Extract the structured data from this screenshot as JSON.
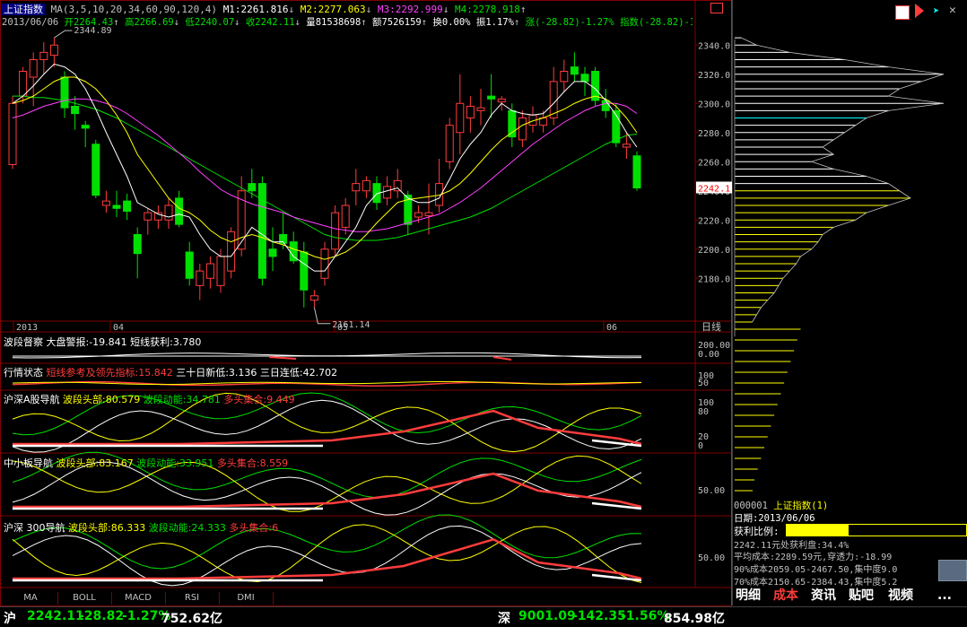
{
  "header": {
    "title": "上证指数",
    "ma_label": "MA(3,5,10,20,34,60,90,120,4)",
    "m1": "M1:2261.816",
    "m2": "M2:2277.063",
    "m3": "M3:2292.999",
    "m4": "M4:2278.918",
    "date": "2013/06/06",
    "open": "开2264.43",
    "high": "高2266.69",
    "low": "低2240.07",
    "close": "收2242.11",
    "volume": "量81538698",
    "amount": "额7526159",
    "turnover": "换0.00%",
    "amplitude": "振1.17%",
    "change": "涨(-28.82)-1.27%",
    "index": "指数(-28.82)-1.27"
  },
  "annotations": {
    "high_label": "2344.89",
    "low_label": "2161.14",
    "current_price": "2242.1"
  },
  "x_axis": {
    "labels": [
      "2013",
      "04",
      "05",
      "06"
    ],
    "period": "日线"
  },
  "indicators": [
    {
      "name": "波段督察",
      "items": [
        {
          "text": "大盘警报:-19.841",
          "color": "#ffffff"
        },
        {
          "text": "短线获利:3.780",
          "color": "#ffffff"
        }
      ],
      "axis": [
        "200.00",
        "0.00"
      ]
    },
    {
      "name": "行情状态",
      "items": [
        {
          "text": "短线参考及领先指标:15.842",
          "color": "#ff3c3c"
        },
        {
          "text": "三十日新低:3.136",
          "color": "#ffffff"
        },
        {
          "text": "三日连低:42.702",
          "color": "#ffffff"
        }
      ],
      "axis": [
        "100",
        "50"
      ]
    },
    {
      "name": "沪深A股导航",
      "items": [
        {
          "text": "波段头部:80.579",
          "color": "#ffff00"
        },
        {
          "text": "波段动能:34.781",
          "color": "#00e000"
        },
        {
          "text": "多头集合:9.449",
          "color": "#ff3c3c"
        }
      ],
      "axis": [
        "100",
        "80",
        "20",
        "0"
      ]
    },
    {
      "name": "中小板导航",
      "items": [
        {
          "text": "波段头部:83.167",
          "color": "#ffff00"
        },
        {
          "text": "波段动能:33.951",
          "color": "#00e000"
        },
        {
          "text": "多头集合:8.559",
          "color": "#ff3c3c"
        }
      ],
      "axis": [
        "50.00"
      ]
    },
    {
      "name": "沪深 300导航",
      "items": [
        {
          "text": "波段头部:86.333",
          "color": "#ffff00"
        },
        {
          "text": "波段动能:24.333",
          "color": "#00e000"
        },
        {
          "text": "多头集合:6",
          "color": "#ff3c3c"
        }
      ],
      "axis": [
        "50.00"
      ]
    }
  ],
  "bottom_tabs": [
    "MA",
    "BOLL",
    "MACD",
    "RSI",
    "DMI"
  ],
  "status_bar": {
    "sh_label": "沪",
    "sh_value": "2242.11",
    "sh_change": "-28.82",
    "sh_pct": "-1.27%",
    "sh_amount": "752.62亿",
    "sz_label": "深",
    "sz_value": "9001.09",
    "sz_change": "-142.35",
    "sz_pct": "-1.56%",
    "sz_amount": "854.98亿"
  },
  "right_panel": {
    "code": "000001",
    "name": "上证指数(1)",
    "date": "日期:2013/06/06",
    "profit_label": "获利比例:",
    "profit_value": "34.4%",
    "profit_fraction": 0.344,
    "line1": "2242.11元处获利盘:34.4%",
    "line2": "平均成本:2289.59元,穿透力:-18.99",
    "line3": "90%成本2059.05-2467.50,集中度9.0",
    "line4": "70%成本2150.65-2384.43,集中度5.2",
    "tabs": [
      "明细",
      "成本",
      "资讯",
      "贴吧",
      "视频"
    ],
    "more": "..."
  },
  "colors": {
    "up": "#ff3c3c",
    "down": "#00e000",
    "ma5": "#ffffff",
    "ma10": "#ffff00",
    "ma20": "#ff40ff",
    "ma60": "#00e000",
    "frame": "#800000"
  },
  "chart_data": {
    "type": "candlestick",
    "title": "上证指数",
    "ylim": [
      2150,
      2350
    ],
    "yticks": [
      2180,
      2200,
      2220,
      2240,
      2260,
      2280,
      2300,
      2320,
      2340
    ],
    "candles": [
      {
        "o": 2258,
        "h": 2305,
        "l": 2255,
        "c": 2300
      },
      {
        "o": 2305,
        "h": 2325,
        "l": 2300,
        "c": 2322
      },
      {
        "o": 2318,
        "h": 2335,
        "l": 2298,
        "c": 2330
      },
      {
        "o": 2330,
        "h": 2342,
        "l": 2320,
        "c": 2335
      },
      {
        "o": 2333,
        "h": 2345,
        "l": 2325,
        "c": 2340
      },
      {
        "o": 2318,
        "h": 2322,
        "l": 2290,
        "c": 2297
      },
      {
        "o": 2298,
        "h": 2305,
        "l": 2282,
        "c": 2293
      },
      {
        "o": 2285,
        "h": 2288,
        "l": 2270,
        "c": 2283
      },
      {
        "o": 2272,
        "h": 2275,
        "l": 2235,
        "c": 2237
      },
      {
        "o": 2230,
        "h": 2240,
        "l": 2225,
        "c": 2233
      },
      {
        "o": 2230,
        "h": 2240,
        "l": 2222,
        "c": 2228
      },
      {
        "o": 2233,
        "h": 2238,
        "l": 2220,
        "c": 2226
      },
      {
        "o": 2210,
        "h": 2215,
        "l": 2180,
        "c": 2197
      },
      {
        "o": 2220,
        "h": 2228,
        "l": 2210,
        "c": 2225
      },
      {
        "o": 2220,
        "h": 2230,
        "l": 2214,
        "c": 2225
      },
      {
        "o": 2220,
        "h": 2235,
        "l": 2214,
        "c": 2230
      },
      {
        "o": 2235,
        "h": 2240,
        "l": 2215,
        "c": 2217
      },
      {
        "o": 2198,
        "h": 2205,
        "l": 2175,
        "c": 2180
      },
      {
        "o": 2175,
        "h": 2190,
        "l": 2165,
        "c": 2185
      },
      {
        "o": 2180,
        "h": 2195,
        "l": 2173,
        "c": 2190
      },
      {
        "o": 2175,
        "h": 2200,
        "l": 2170,
        "c": 2195
      },
      {
        "o": 2185,
        "h": 2215,
        "l": 2180,
        "c": 2212
      },
      {
        "o": 2200,
        "h": 2250,
        "l": 2195,
        "c": 2240
      },
      {
        "o": 2245,
        "h": 2255,
        "l": 2235,
        "c": 2240
      },
      {
        "o": 2245,
        "h": 2250,
        "l": 2175,
        "c": 2180
      },
      {
        "o": 2200,
        "h": 2215,
        "l": 2185,
        "c": 2195
      },
      {
        "o": 2210,
        "h": 2225,
        "l": 2200,
        "c": 2204
      },
      {
        "o": 2205,
        "h": 2212,
        "l": 2190,
        "c": 2192
      },
      {
        "o": 2198,
        "h": 2205,
        "l": 2160,
        "c": 2172
      },
      {
        "o": 2165,
        "h": 2172,
        "l": 2160,
        "c": 2168
      },
      {
        "o": 2180,
        "h": 2205,
        "l": 2175,
        "c": 2200
      },
      {
        "o": 2200,
        "h": 2230,
        "l": 2195,
        "c": 2225
      },
      {
        "o": 2215,
        "h": 2235,
        "l": 2210,
        "c": 2230
      },
      {
        "o": 2240,
        "h": 2255,
        "l": 2230,
        "c": 2245
      },
      {
        "o": 2240,
        "h": 2250,
        "l": 2235,
        "c": 2247
      },
      {
        "o": 2245,
        "h": 2250,
        "l": 2227,
        "c": 2232
      },
      {
        "o": 2235,
        "h": 2250,
        "l": 2230,
        "c": 2243
      },
      {
        "o": 2240,
        "h": 2255,
        "l": 2235,
        "c": 2247
      },
      {
        "o": 2237,
        "h": 2240,
        "l": 2210,
        "c": 2217
      },
      {
        "o": 2222,
        "h": 2230,
        "l": 2218,
        "c": 2225
      },
      {
        "o": 2223,
        "h": 2245,
        "l": 2210,
        "c": 2225
      },
      {
        "o": 2230,
        "h": 2262,
        "l": 2225,
        "c": 2245
      },
      {
        "o": 2260,
        "h": 2290,
        "l": 2255,
        "c": 2285
      },
      {
        "o": 2280,
        "h": 2320,
        "l": 2265,
        "c": 2300
      },
      {
        "o": 2290,
        "h": 2305,
        "l": 2280,
        "c": 2298
      },
      {
        "o": 2295,
        "h": 2310,
        "l": 2285,
        "c": 2297
      },
      {
        "o": 2305,
        "h": 2320,
        "l": 2290,
        "c": 2303
      },
      {
        "o": 2301,
        "h": 2305,
        "l": 2295,
        "c": 2303
      },
      {
        "o": 2295,
        "h": 2300,
        "l": 2270,
        "c": 2277
      },
      {
        "o": 2275,
        "h": 2295,
        "l": 2270,
        "c": 2290
      },
      {
        "o": 2285,
        "h": 2298,
        "l": 2280,
        "c": 2292
      },
      {
        "o": 2285,
        "h": 2295,
        "l": 2280,
        "c": 2290
      },
      {
        "o": 2290,
        "h": 2325,
        "l": 2285,
        "c": 2315
      },
      {
        "o": 2315,
        "h": 2330,
        "l": 2308,
        "c": 2322
      },
      {
        "o": 2325,
        "h": 2335,
        "l": 2315,
        "c": 2320
      },
      {
        "o": 2320,
        "h": 2325,
        "l": 2305,
        "c": 2315
      },
      {
        "o": 2322,
        "h": 2325,
        "l": 2298,
        "c": 2302
      },
      {
        "o": 2302,
        "h": 2310,
        "l": 2290,
        "c": 2295
      },
      {
        "o": 2295,
        "h": 2300,
        "l": 2270,
        "c": 2273
      },
      {
        "o": 2270,
        "h": 2280,
        "l": 2262,
        "c": 2272
      },
      {
        "o": 2264,
        "h": 2267,
        "l": 2240,
        "c": 2242
      }
    ],
    "ma5": [
      2300,
      2305,
      2312,
      2320,
      2327,
      2325,
      2320,
      2310,
      2296,
      2280,
      2265,
      2250,
      2232,
      2228,
      2224,
      2222,
      2224,
      2222,
      2210,
      2200,
      2195,
      2195,
      2205,
      2215,
      2210,
      2205,
      2205,
      2195,
      2190,
      2185,
      2185,
      2195,
      2205,
      2215,
      2230,
      2238,
      2240,
      2242,
      2235,
      2232,
      2232,
      2235,
      2248,
      2262,
      2272,
      2280,
      2292,
      2300,
      2295,
      2293,
      2292,
      2293,
      2300,
      2308,
      2315,
      2315,
      2310,
      2302,
      2292,
      2280,
      2270
    ],
    "ma10": [
      2300,
      2302,
      2305,
      2310,
      2315,
      2318,
      2318,
      2315,
      2310,
      2302,
      2292,
      2280,
      2265,
      2255,
      2245,
      2235,
      2228,
      2225,
      2220,
      2213,
      2208,
      2205,
      2208,
      2210,
      2208,
      2205,
      2203,
      2200,
      2198,
      2195,
      2193,
      2195,
      2198,
      2203,
      2210,
      2218,
      2225,
      2232,
      2234,
      2235,
      2236,
      2237,
      2240,
      2245,
      2252,
      2260,
      2268,
      2275,
      2280,
      2285,
      2288,
      2290,
      2293,
      2296,
      2300,
      2303,
      2305,
      2303,
      2298,
      2290,
      2280
    ],
    "ma20": [
      2290,
      2292,
      2295,
      2298,
      2300,
      2302,
      2303,
      2303,
      2302,
      2300,
      2297,
      2293,
      2288,
      2283,
      2278,
      2272,
      2266,
      2260,
      2253,
      2247,
      2241,
      2237,
      2234,
      2231,
      2229,
      2227,
      2225,
      2222,
      2220,
      2218,
      2216,
      2214,
      2213,
      2212,
      2212,
      2213,
      2214,
      2216,
      2218,
      2220,
      2222,
      2224,
      2228,
      2232,
      2237,
      2242,
      2248,
      2254,
      2260,
      2266,
      2272,
      2277,
      2282,
      2287,
      2291,
      2295,
      2298,
      2300,
      2300,
      2298,
      2293
    ],
    "ma60": [
      2305,
      2305,
      2304,
      2304,
      2303,
      2302,
      2300,
      2298,
      2296,
      2293,
      2290,
      2286,
      2282,
      2278,
      2274,
      2270,
      2266,
      2262,
      2258,
      2254,
      2250,
      2246,
      2242,
      2238,
      2234,
      2230,
      2226,
      2222,
      2218,
      2214,
      2210,
      2208,
      2207,
      2206,
      2206,
      2206,
      2207,
      2208,
      2210,
      2212,
      2214,
      2216,
      2218,
      2220,
      2222,
      2225,
      2228,
      2232,
      2236,
      2240,
      2244,
      2248,
      2252,
      2256,
      2260,
      2264,
      2268,
      2272,
      2275,
      2278,
      2279
    ],
    "profile_levels": [
      2345,
      2340,
      2335,
      2330,
      2325,
      2320,
      2315,
      2310,
      2305,
      2300,
      2295,
      2290,
      2285,
      2280,
      2275,
      2270,
      2265,
      2260,
      2255,
      2250,
      2245,
      2240,
      2235,
      2230,
      2225,
      2220,
      2215,
      2210,
      2205,
      2200,
      2195,
      2190,
      2185,
      2180,
      2175,
      2170,
      2165,
      2160,
      2155,
      2150
    ],
    "profile_widths": [
      0.03,
      0.1,
      0.25,
      0.5,
      0.7,
      0.95,
      0.85,
      0.75,
      0.7,
      0.95,
      0.7,
      0.6,
      0.55,
      0.5,
      0.45,
      0.4,
      0.45,
      0.35,
      0.45,
      0.6,
      0.7,
      0.75,
      0.8,
      0.7,
      0.6,
      0.55,
      0.45,
      0.4,
      0.38,
      0.35,
      0.3,
      0.28,
      0.25,
      0.22,
      0.2,
      0.18,
      0.15,
      0.12,
      0.1,
      0.08
    ]
  }
}
